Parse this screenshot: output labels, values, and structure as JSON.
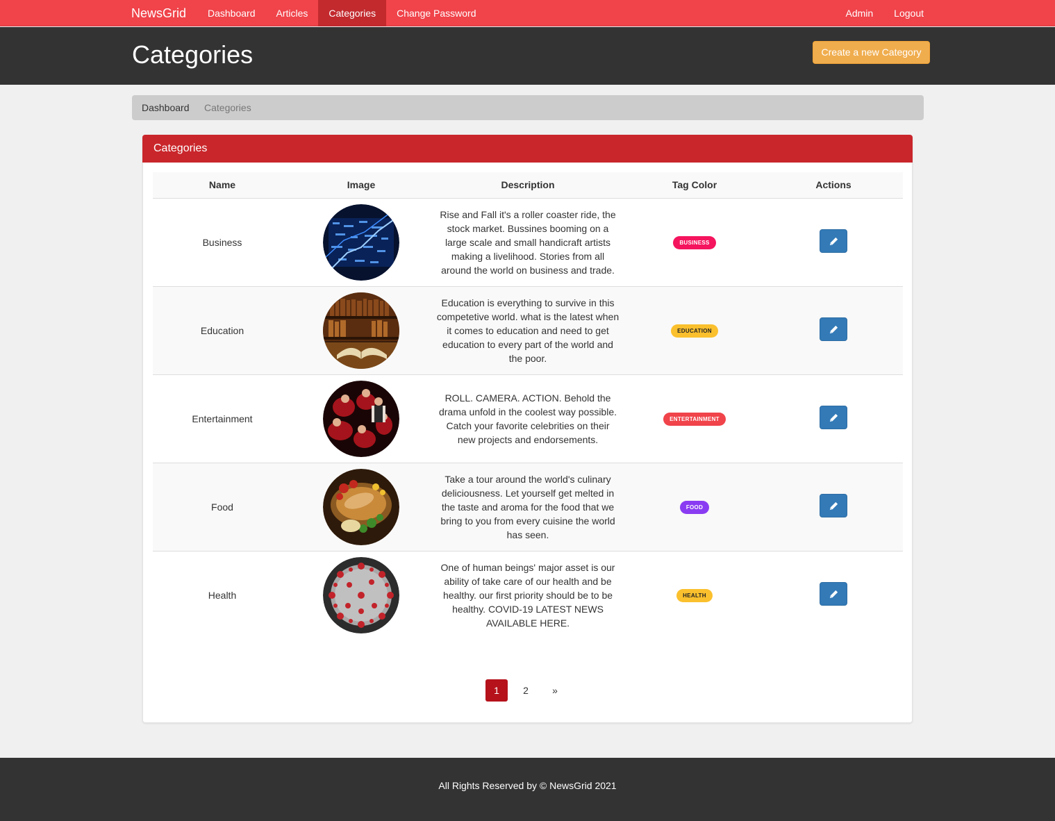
{
  "navbar": {
    "brand": "NewsGrid",
    "items": [
      {
        "label": "Dashboard"
      },
      {
        "label": "Articles"
      },
      {
        "label": "Categories"
      },
      {
        "label": "Change Password"
      }
    ],
    "right_items": [
      {
        "label": "Admin"
      },
      {
        "label": "Logout"
      }
    ],
    "active_item": "Categories",
    "color": "#f0434a"
  },
  "header": {
    "title": "Categories",
    "create_button": "Create a new Category"
  },
  "breadcrumb": {
    "items": [
      "Dashboard",
      "Categories"
    ]
  },
  "panel": {
    "title": "Categories",
    "columns": [
      "Name",
      "Image",
      "Description",
      "Tag Color",
      "Actions"
    ],
    "rows": [
      {
        "name": "Business",
        "image": "stock-market-image",
        "description": "Rise and Fall it's a roller coaster ride, the stock market. Bussines booming on a large scale and small handicraft artists making a livelihood. Stories from all around the world on business and trade.",
        "tag": "BUSINESS",
        "tag_color": "#f5145e"
      },
      {
        "name": "Education",
        "image": "library-book-image",
        "description": "Education is everything to survive in this competetive world. what is the latest when it comes to education and need to get education to every part of the world and the poor.",
        "tag": "EDUCATION",
        "tag_color": "#fbc02d"
      },
      {
        "name": "Entertainment",
        "image": "movie-cast-image",
        "description": "ROLL. CAMERA. ACTION. Behold the drama unfold in the coolest way possible. Catch your favorite celebrities on their new projects and endorsements.",
        "tag": "ENTERTAINMENT",
        "tag_color": "#f0434a"
      },
      {
        "name": "Food",
        "image": "food-platter-image",
        "description": "Take a tour around the world's culinary deliciousness. Let yourself get melted in the taste and aroma for the food that we bring to you from every cuisine the world has seen.",
        "tag": "FOOD",
        "tag_color": "#8a3cf2"
      },
      {
        "name": "Health",
        "image": "virus-image",
        "description": "One of human beings' major asset is our ability of take care of our health and be healthy. our first priority should be to be healthy. COVID-19 LATEST NEWS AVAILABLE HERE.",
        "tag": "HEALTH",
        "tag_color": "#fbc02d"
      }
    ],
    "edit_icon": "pencil-icon"
  },
  "pagination": {
    "pages": [
      "1",
      "2"
    ],
    "current": "1",
    "next": "»"
  },
  "footer": {
    "text": "All Rights Reserved by © NewsGrid 2021"
  }
}
